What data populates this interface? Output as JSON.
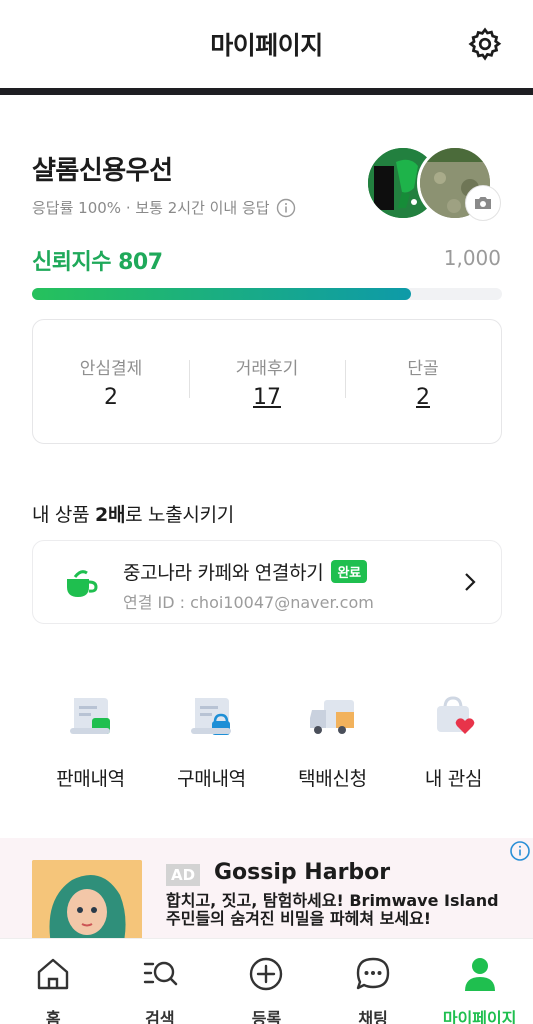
{
  "header": {
    "title": "마이페이지"
  },
  "profile": {
    "name": "샬롬신용우선",
    "meta": "응답률 100% · 보통 2시간 이내 응답"
  },
  "trust": {
    "label": "신뢰지수 807",
    "value": 807,
    "max_label": "1,000",
    "max": 1000
  },
  "stats": [
    {
      "label": "안심결제",
      "value": "2"
    },
    {
      "label": "거래후기",
      "value": "17"
    },
    {
      "label": "단골",
      "value": "2"
    }
  ],
  "expose": {
    "prefix": "내 상품 ",
    "bold": "2배",
    "suffix": "로 노출시키기"
  },
  "cafe": {
    "title": "중고나라 카페와 연결하기",
    "badge": "완료",
    "sub": "연결 ID : choi10047@naver.com"
  },
  "menu": [
    {
      "label": "판매내역",
      "icon": "sales-history-icon"
    },
    {
      "label": "구매내역",
      "icon": "purchase-history-icon"
    },
    {
      "label": "택배신청",
      "icon": "delivery-truck-icon"
    },
    {
      "label": "내 관심",
      "icon": "heart-bag-icon"
    }
  ],
  "ad": {
    "tag": "AD",
    "title": "Gossip Harbor",
    "desc": "합치고, 짓고, 탐험하세요! Brimwave Island 주민들의 숨겨진 비밀을 파헤쳐 보세요!"
  },
  "tabs": [
    {
      "label": "홈"
    },
    {
      "label": "검색"
    },
    {
      "label": "등록"
    },
    {
      "label": "채팅"
    },
    {
      "label": "마이페이지"
    }
  ],
  "colors": {
    "accent": "#1fbf4f",
    "trust": "#1fa95a"
  }
}
